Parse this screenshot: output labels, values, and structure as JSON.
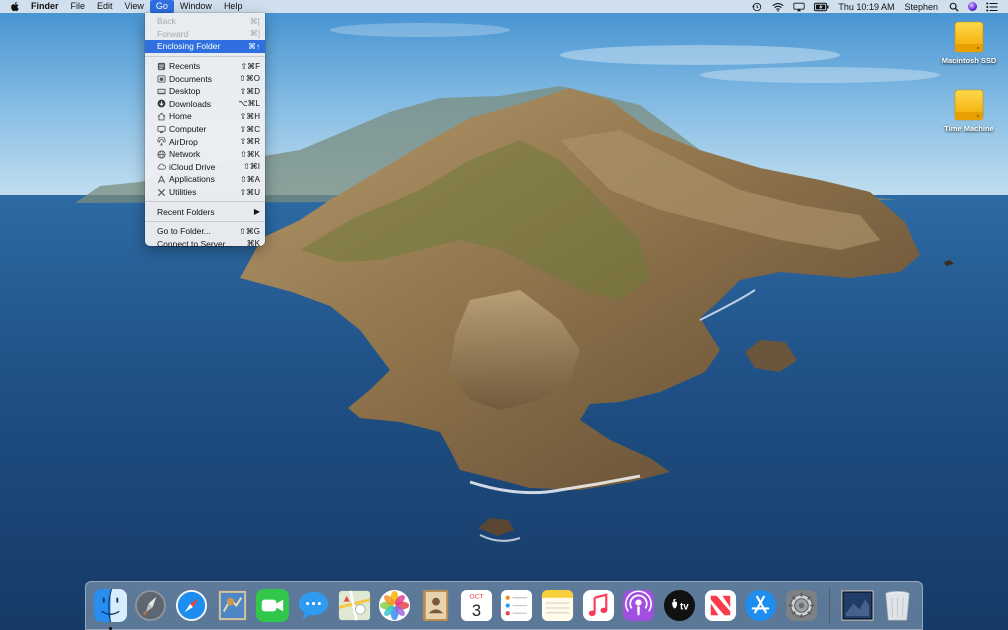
{
  "menubar": {
    "apple_icon": "apple-logo-icon",
    "items": [
      {
        "label": "Finder",
        "bold": true
      },
      {
        "label": "File"
      },
      {
        "label": "Edit"
      },
      {
        "label": "View"
      },
      {
        "label": "Go",
        "active": true
      },
      {
        "label": "Window"
      },
      {
        "label": "Help"
      }
    ],
    "status": {
      "icons": [
        "time-machine-icon",
        "wifi-icon",
        "airplay-icon",
        "battery-icon"
      ],
      "datetime": "Thu 10:19 AM",
      "user": "Stephen",
      "trailing_icons": [
        "spotlight-search-icon",
        "siri-icon",
        "notification-center-icon"
      ]
    }
  },
  "go_menu": {
    "sections": [
      [
        {
          "label": "Back",
          "shortcut": "⌘[",
          "disabled": true
        },
        {
          "label": "Forward",
          "shortcut": "⌘]",
          "disabled": true
        },
        {
          "label": "Enclosing Folder",
          "shortcut": "⌘↑",
          "highlight": true
        }
      ],
      [
        {
          "label": "Recents",
          "shortcut": "⇧⌘F",
          "icon": "recents-icon"
        },
        {
          "label": "Documents",
          "shortcut": "⇧⌘O",
          "icon": "documents-icon"
        },
        {
          "label": "Desktop",
          "shortcut": "⇧⌘D",
          "icon": "desktop-icon"
        },
        {
          "label": "Downloads",
          "shortcut": "⌥⌘L",
          "icon": "downloads-icon"
        },
        {
          "label": "Home",
          "shortcut": "⇧⌘H",
          "icon": "home-icon"
        },
        {
          "label": "Computer",
          "shortcut": "⇧⌘C",
          "icon": "computer-icon"
        },
        {
          "label": "AirDrop",
          "shortcut": "⇧⌘R",
          "icon": "airdrop-icon"
        },
        {
          "label": "Network",
          "shortcut": "⇧⌘K",
          "icon": "network-icon"
        },
        {
          "label": "iCloud Drive",
          "shortcut": "⇧⌘I",
          "icon": "icloud-icon"
        },
        {
          "label": "Applications",
          "shortcut": "⇧⌘A",
          "icon": "applications-icon"
        },
        {
          "label": "Utilities",
          "shortcut": "⇧⌘U",
          "icon": "utilities-icon"
        }
      ],
      [
        {
          "label": "Recent Folders",
          "shortcut": "▶",
          "submenu": true
        }
      ],
      [
        {
          "label": "Go to Folder...",
          "shortcut": "⇧⌘G"
        },
        {
          "label": "Connect to Server...",
          "shortcut": "⌘K"
        }
      ]
    ]
  },
  "desktop": {
    "icons": [
      {
        "label": "Macintosh SSD",
        "icon": "hard-drive-icon"
      },
      {
        "label": "Time Machine",
        "icon": "external-drive-icon"
      }
    ]
  },
  "dock": {
    "apps": [
      {
        "name": "Finder",
        "icon": "finder-icon",
        "running": true
      },
      {
        "name": "Launchpad",
        "icon": "launchpad-icon"
      },
      {
        "name": "Safari",
        "icon": "safari-icon"
      },
      {
        "name": "Mail",
        "icon": "mail-icon"
      },
      {
        "name": "FaceTime",
        "icon": "facetime-icon"
      },
      {
        "name": "Messages",
        "icon": "messages-icon"
      },
      {
        "name": "Maps",
        "icon": "maps-icon"
      },
      {
        "name": "Photos",
        "icon": "photos-icon"
      },
      {
        "name": "Contacts",
        "icon": "contacts-icon"
      },
      {
        "name": "Calendar",
        "icon": "calendar-icon",
        "month": "OCT",
        "day": "3"
      },
      {
        "name": "Reminders",
        "icon": "reminders-icon"
      },
      {
        "name": "Notes",
        "icon": "notes-icon"
      },
      {
        "name": "Music",
        "icon": "music-icon"
      },
      {
        "name": "Podcasts",
        "icon": "podcasts-icon"
      },
      {
        "name": "TV",
        "icon": "tv-icon",
        "text": "tv"
      },
      {
        "name": "News",
        "icon": "news-icon"
      },
      {
        "name": "App Store",
        "icon": "app-store-icon"
      },
      {
        "name": "System Preferences",
        "icon": "system-preferences-icon"
      }
    ],
    "trailing": [
      {
        "name": "Downloads Stack",
        "icon": "downloads-stack-icon"
      },
      {
        "name": "Trash",
        "icon": "trash-icon"
      }
    ]
  }
}
